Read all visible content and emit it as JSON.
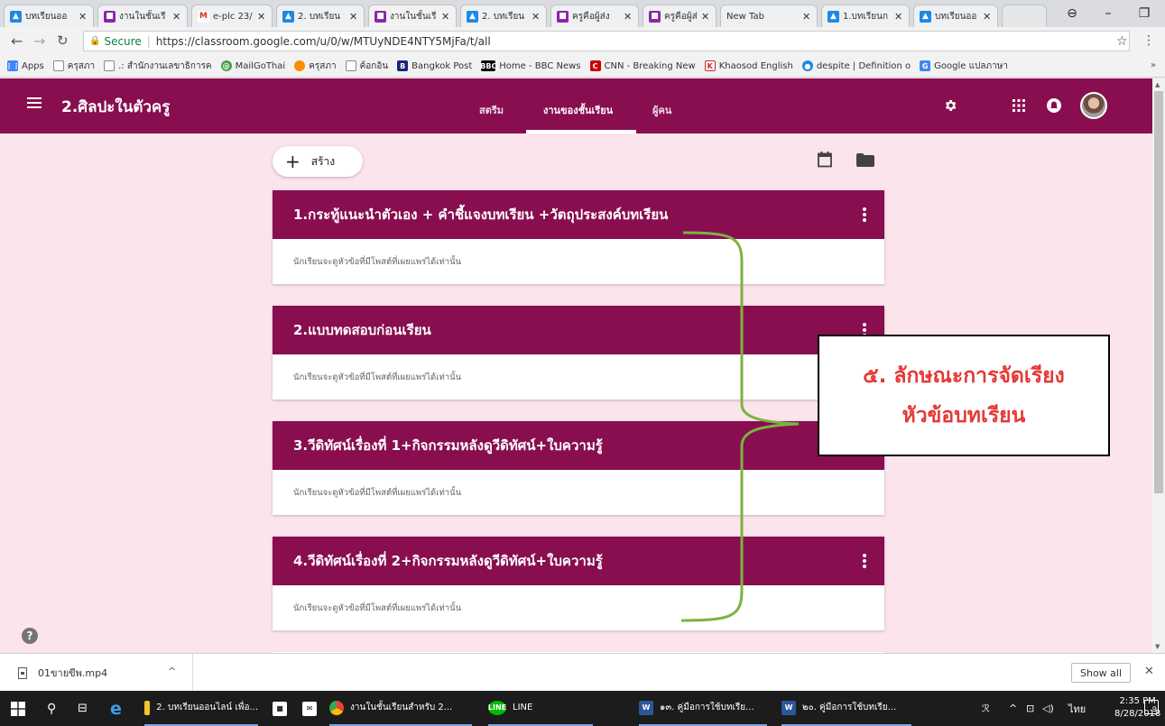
{
  "browser": {
    "tabs": [
      {
        "title": "บทเรียนออ",
        "icon": "drive-icon",
        "color": "#1e88e5"
      },
      {
        "title": "งานในชั้นเรี",
        "icon": "classroom-icon",
        "color": "#8e24aa"
      },
      {
        "title": "e-plc 23/",
        "icon": "gmail-icon",
        "color": "#d93025"
      },
      {
        "title": "2. บทเรียน",
        "icon": "drive-icon",
        "color": "#1e88e5"
      },
      {
        "title": "งานในชั้นเรี",
        "icon": "classroom-icon",
        "color": "#8e24aa",
        "active": true
      },
      {
        "title": "2. บทเรียน",
        "icon": "drive-icon",
        "color": "#1e88e5"
      },
      {
        "title": "ครูคือผู้ส่ง",
        "icon": "classroom-icon",
        "color": "#8e24aa"
      },
      {
        "title": "ครูคือผู้ส่ง",
        "icon": "classroom-icon",
        "color": "#8e24aa"
      },
      {
        "title": "New Tab",
        "icon": "",
        "color": ""
      },
      {
        "title": "1.บทเรียนก",
        "icon": "drive-icon",
        "color": "#1e88e5"
      },
      {
        "title": "บทเรียนออ",
        "icon": "drive-icon",
        "color": "#1e88e5"
      }
    ],
    "secure_label": "Secure",
    "url": "https://classroom.google.com/u/0/w/MTUyNDE4NTY5MjFa/t/all",
    "bookmarks": [
      {
        "label": "Apps",
        "icon": "apps-icon",
        "color": "#4285f4"
      },
      {
        "label": "ครุสภา",
        "icon": "page-icon",
        "color": "#9e9e9e"
      },
      {
        "label": ".: สำนักงานเลขาธิการค",
        "icon": "page-icon",
        "color": "#9e9e9e"
      },
      {
        "label": "MailGoThai",
        "icon": "mail-icon",
        "color": "#43a047"
      },
      {
        "label": "ครุสภา",
        "icon": "site-icon",
        "color": "#fb8c00"
      },
      {
        "label": "ค้อกอิน",
        "icon": "page-icon",
        "color": "#9e9e9e"
      },
      {
        "label": "Bangkok Post",
        "icon": "news-icon",
        "color": "#1a237e"
      },
      {
        "label": "Home - BBC News",
        "icon": "bbc-icon",
        "color": "#000000"
      },
      {
        "label": "CNN - Breaking New",
        "icon": "cnn-icon",
        "color": "#cc0000"
      },
      {
        "label": "Khaosod English",
        "icon": "khaosod-icon",
        "color": "#c62828"
      },
      {
        "label": "despite | Definition o",
        "icon": "dictionary-icon",
        "color": "#1e88e5"
      },
      {
        "label": "Google แปลภาษา",
        "icon": "translate-icon",
        "color": "#4285f4"
      }
    ],
    "bookmarks_more": "»"
  },
  "classroom": {
    "class_name": "2.ศิลปะในตัวครู",
    "nav": [
      {
        "label": "สตรีม",
        "active": false
      },
      {
        "label": "งานของชั้นเรียน",
        "active": true
      },
      {
        "label": "ผู้คน",
        "active": false
      }
    ],
    "create_label": "สร้าง",
    "topics": [
      {
        "title": "1.กระทู้แนะนำตัวเอง + คำชี้แจงบทเรียน +วัตถุประสงค์บทเรียน",
        "body": "นักเรียนจะดูหัวข้อที่มีโพสต์ที่เผยแพร่ได้เท่านั้น"
      },
      {
        "title": "2.แบบทดสอบก่อนเรียน",
        "body": "นักเรียนจะดูหัวข้อที่มีโพสต์ที่เผยแพร่ได้เท่านั้น"
      },
      {
        "title": "3.วีดิทัศน์เรื่องที่ 1+กิจกรรมหลังดูวีดิทัศน์+ใบความรู้",
        "body": "นักเรียนจะดูหัวข้อที่มีโพสต์ที่เผยแพร่ได้เท่านั้น"
      },
      {
        "title": "4.วีดิทัศน์เรื่องที่ 2+กิจกรรมหลังดูวีดิทัศน์+ใบความรู้",
        "body": "นักเรียนจะดูหัวข้อที่มีโพสต์ที่เผยแพร่ได้เท่านั้น"
      }
    ],
    "brand_color": "#880e4f",
    "background_color": "#fce4ec"
  },
  "annotation": {
    "line1": "๕. ลักษณะการจัดเรียง",
    "line2": "หัวข้อบทเรียน",
    "text_color": "#e53935",
    "bracket_color": "#7cb342"
  },
  "downloads": {
    "file_name": "01ขายขีพ.mp4",
    "show_all": "Show all"
  },
  "taskbar": {
    "items": [
      {
        "label": "2. บทเรียนออนไลน์ เพื่อ...",
        "icon": "folder-icon"
      },
      {
        "label": "",
        "icon": "store-icon"
      },
      {
        "label": "",
        "icon": "mail-icon"
      },
      {
        "label": "งานในชั้นเรียนสำหรับ 2...",
        "icon": "chrome-icon"
      },
      {
        "label": "LINE",
        "icon": "line-icon"
      },
      {
        "label": "๑๓. คู่มือการใช้บทเรีย...",
        "icon": "word-icon"
      },
      {
        "label": "๒๐. คู่มือการใช้บทเรีย...",
        "icon": "word-icon"
      }
    ],
    "language": "ไทย",
    "time": "2:35 PM",
    "date": "8/28/2018",
    "notification_count": "9"
  }
}
